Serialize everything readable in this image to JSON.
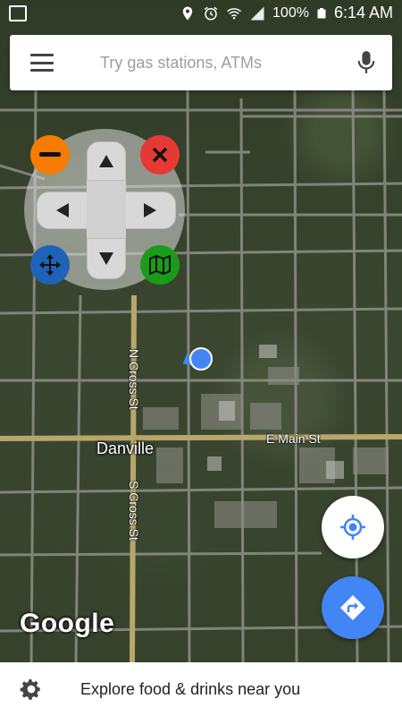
{
  "status_bar": {
    "battery": "100%",
    "time": "6:14 AM"
  },
  "search": {
    "placeholder": "Try gas stations, ATMs"
  },
  "map": {
    "streets": {
      "n_cross": "N Cross St",
      "s_cross": "S Cross St",
      "e_main": "E Main St"
    },
    "city": "Danville",
    "logo": "Google"
  },
  "bottom_bar": {
    "explore_text": "Explore food & drinks near you"
  },
  "colors": {
    "zoom_out": "#f57c00",
    "close": "#e53935",
    "move": "#1e63b8",
    "map_toggle": "#1a9c1a",
    "accent_blue": "#4285f4"
  },
  "icons": {
    "status_left": "gallery-icon",
    "location": "location-pin-icon",
    "alarm": "alarm-icon",
    "wifi": "wifi-icon",
    "signal": "signal-icon",
    "battery": "battery-icon"
  }
}
